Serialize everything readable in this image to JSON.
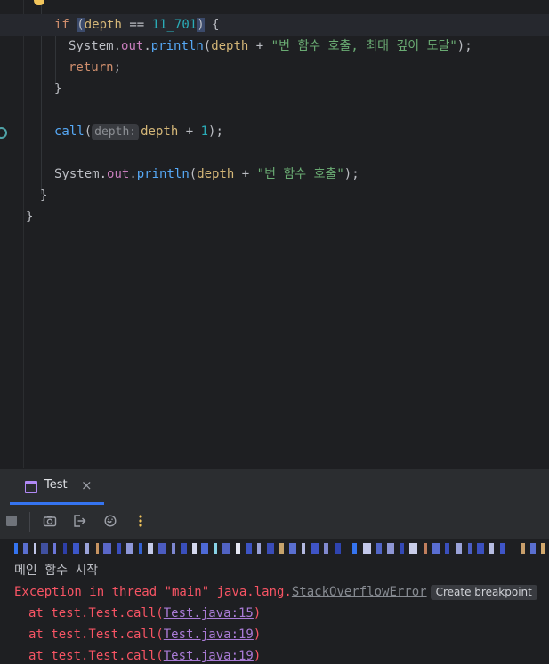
{
  "editor": {
    "line1": {
      "kw_if": "if",
      "open_paren": "(",
      "var": "depth",
      "op": " == ",
      "num": "11_701",
      "close_paren": ")",
      "brace": " {"
    },
    "line2": {
      "cls": "System",
      "dot1": ".",
      "field": "out",
      "dot2": ".",
      "method": "println",
      "open": "(",
      "var": "depth",
      "plus": " + ",
      "str": "\"번 함수 호출, 최대 깊이 도달\"",
      "close": ");"
    },
    "line3": {
      "kw": "return",
      "semi": ";"
    },
    "line4": {
      "brace": "}"
    },
    "line6": {
      "method": "call",
      "open": "(",
      "hint": "depth:",
      "var": "depth",
      "plus": " + ",
      "num": "1",
      "close": ");"
    },
    "line8": {
      "cls": "System",
      "dot1": ".",
      "field": "out",
      "dot2": ".",
      "method": "println",
      "open": "(",
      "var": "depth",
      "plus": " + ",
      "str": "\"번 함수 호출\"",
      "close": ");"
    },
    "line9": {
      "brace": "}"
    },
    "line10": {
      "brace": "}"
    }
  },
  "run_panel": {
    "tab_label": "Test",
    "tab_close": "×"
  },
  "console": {
    "line1": "메인 함수 시작",
    "exception_prefix": "Exception in thread \"main\" java.lang.",
    "exception_class": "StackOverflowError",
    "create_breakpoint": "Create breakpoint",
    "trace_prefix": "at test.Test.call(",
    "trace_suffix": ")",
    "trace": [
      "Test.java:15",
      "Test.java:19",
      "Test.java:19"
    ]
  },
  "colors": {
    "background": "#1e1f22",
    "keyword": "#cf8e6d",
    "method": "#56a8f5",
    "string": "#6aab73",
    "number": "#2aacb8",
    "error": "#f75464",
    "accent": "#3574f0"
  },
  "icons": {
    "toolbar": [
      "stop-icon",
      "camera-icon",
      "exit-icon",
      "settings-icon",
      "more-vertical-icon"
    ]
  }
}
